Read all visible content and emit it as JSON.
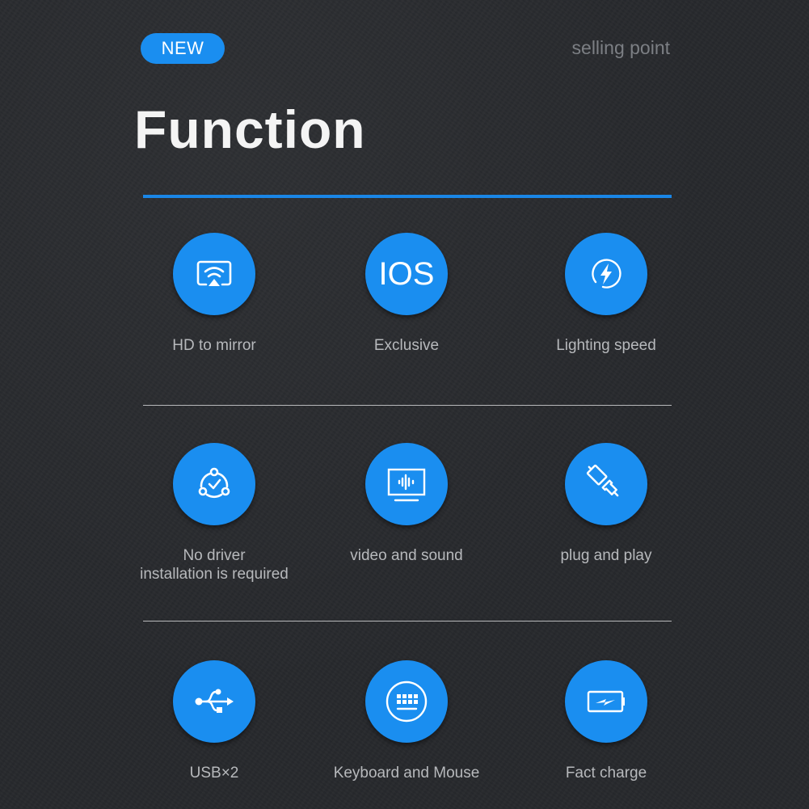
{
  "header": {
    "badge": "NEW",
    "tagline": "selling point",
    "title": "Function"
  },
  "colors": {
    "accent": "#1a8ef0",
    "background": "#27292d",
    "label": "#b7b9bc"
  },
  "features": [
    {
      "icon": "screen-mirror-icon",
      "label": "HD to mirror"
    },
    {
      "icon": "ios-icon",
      "icon_text": "IOS",
      "label": "Exclusive"
    },
    {
      "icon": "lightning-icon",
      "label": "Lighting speed"
    },
    {
      "icon": "network-check-icon",
      "label": "No driver\ninstallation is required"
    },
    {
      "icon": "monitor-audio-icon",
      "label": "video and sound"
    },
    {
      "icon": "plug-icon",
      "label": "plug and play"
    },
    {
      "icon": "usb-icon",
      "label": "USB×2"
    },
    {
      "icon": "keyboard-icon",
      "label": "Keyboard and Mouse"
    },
    {
      "icon": "battery-charge-icon",
      "label": "Fact charge"
    }
  ]
}
